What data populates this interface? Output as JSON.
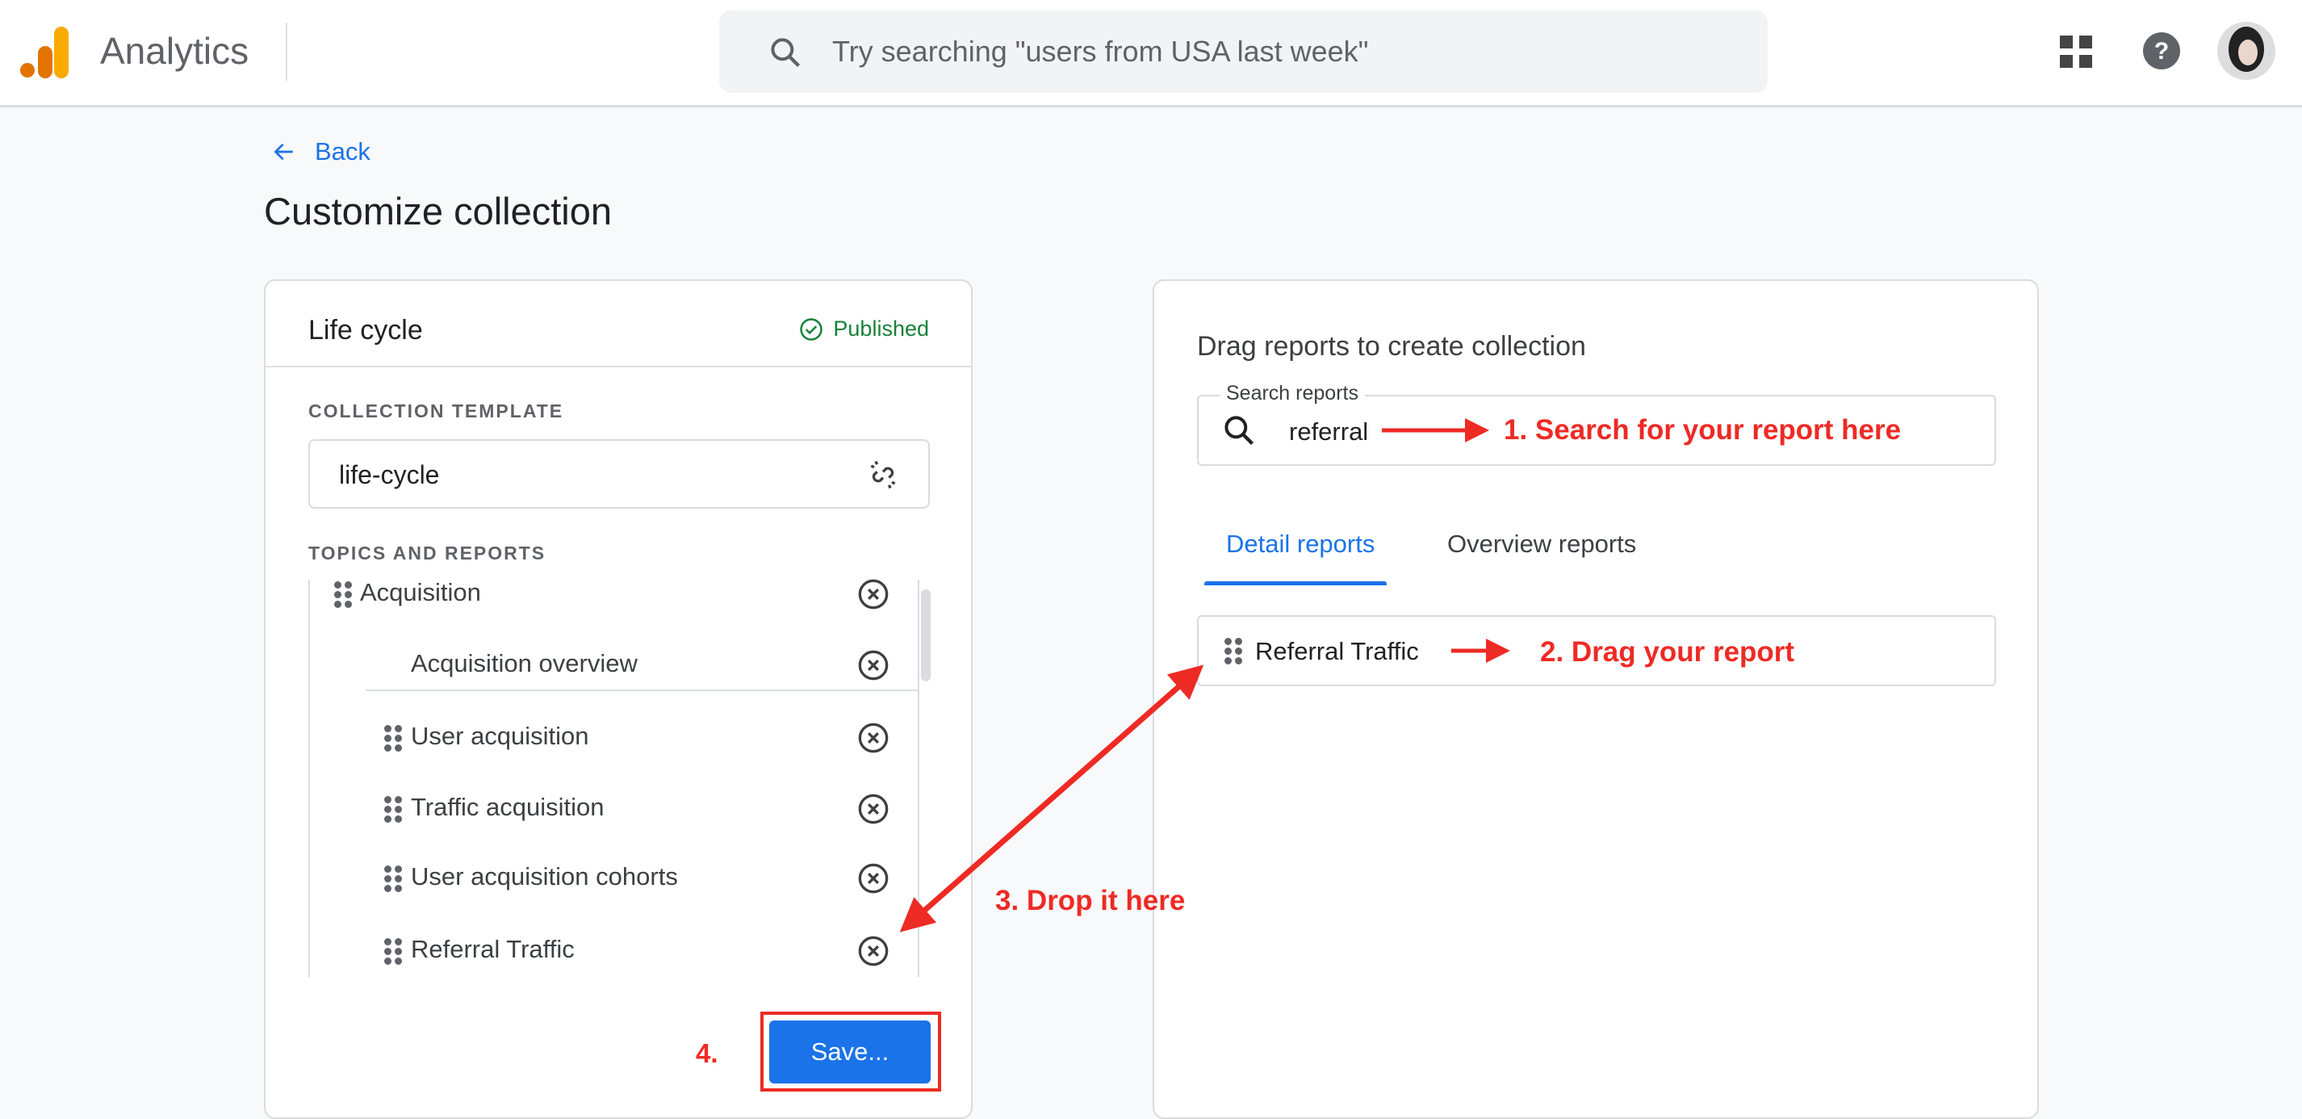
{
  "header": {
    "app_title": "Analytics",
    "search_placeholder": "Try searching \"users from USA last week\"",
    "icons": [
      "analytics-logo",
      "apps-grid-icon",
      "help-icon",
      "avatar"
    ]
  },
  "nav": {
    "back_label": "Back"
  },
  "page": {
    "title": "Customize collection"
  },
  "collection": {
    "name": "Life cycle",
    "status": "Published",
    "status_color": "#188038",
    "template_label": "COLLECTION TEMPLATE",
    "template_value": "life-cycle",
    "topics_label": "TOPICS AND REPORTS",
    "topic": "Acquisition",
    "overview": "Acquisition overview",
    "reports": [
      "User acquisition",
      "Traffic acquisition",
      "User acquisition cohorts",
      "Referral Traffic"
    ],
    "save_label": "Save..."
  },
  "library": {
    "heading": "Drag reports to create collection",
    "search_label": "Search reports",
    "search_value": "referral",
    "tabs": [
      {
        "label": "Detail reports",
        "active": true
      },
      {
        "label": "Overview reports",
        "active": false
      }
    ],
    "results": [
      "Referral Traffic"
    ]
  },
  "annotations": {
    "step1": "1. Search for your report here",
    "step2": "2. Drag your report",
    "step3": "3. Drop it here",
    "step4": "4.",
    "color": "#ee2a24"
  },
  "colors": {
    "accent": "#1a73e8",
    "save_button": "#1a73e8"
  }
}
